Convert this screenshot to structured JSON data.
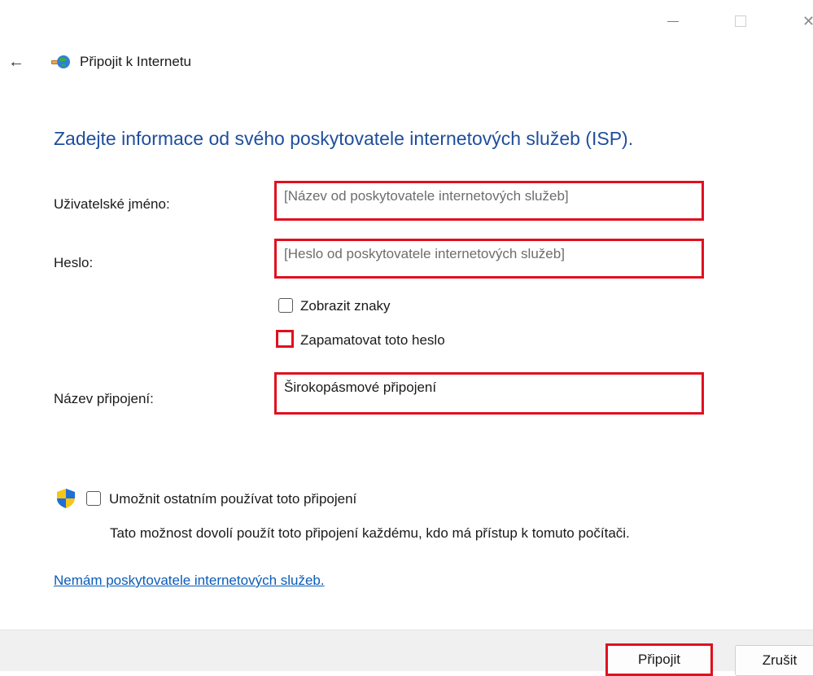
{
  "window": {
    "title": "Připojit k Internetu",
    "controls": {
      "minimize_icon": "minimize-icon",
      "maximize_icon": "maximize-icon",
      "close_icon": "close-icon",
      "close_glyph": "✕"
    },
    "back_glyph": "←"
  },
  "heading": "Zadejte informace od svého poskytovatele internetových služeb (ISP).",
  "form": {
    "username": {
      "label": "Uživatelské jméno:",
      "value": "",
      "placeholder": "[Název od poskytovatele internetových služeb]"
    },
    "password": {
      "label": "Heslo:",
      "value": "",
      "placeholder": "[Heslo od poskytovatele internetových služeb]"
    },
    "show_chars": {
      "label": "Zobrazit znaky",
      "checked": false
    },
    "remember_password": {
      "label": "Zapamatovat toto heslo",
      "checked": false
    },
    "connection_name": {
      "label": "Název připojení:",
      "value": "Širokopásmové připojení",
      "placeholder": ""
    }
  },
  "sharing": {
    "checkbox_label": "Umožnit ostatním používat toto připojení",
    "checked": false,
    "description": "Tato možnost dovolí použít toto připojení každému, kdo má přístup k tomuto počítači.",
    "icon": "uac-shield-icon"
  },
  "no_isp_link": "Nemám poskytovatele internetových služeb.",
  "buttons": {
    "connect": "Připojit",
    "cancel": "Zrušit"
  },
  "colors": {
    "heading": "#1f4e9c",
    "highlight": "#e0101f",
    "link": "#0b5cb8",
    "footer": "#f0f0f0"
  }
}
